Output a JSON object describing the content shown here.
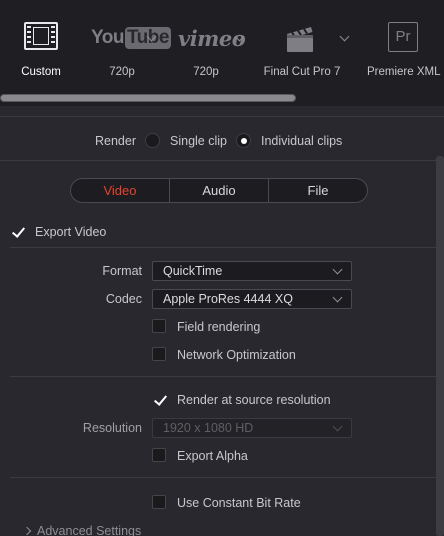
{
  "presets": [
    {
      "id": "custom",
      "label": "Custom",
      "icon": "film-icon",
      "active": true
    },
    {
      "id": "youtube",
      "label": "720p",
      "logo_you": "You",
      "logo_tube": "Tube"
    },
    {
      "id": "vimeo",
      "label": "720p",
      "logo": "vimeo"
    },
    {
      "id": "fcp7",
      "label": "Final Cut Pro 7",
      "icon": "clapperboard-icon"
    },
    {
      "id": "premiere",
      "label": "Premiere XML",
      "logo": "Pr"
    }
  ],
  "render": {
    "label": "Render",
    "options": [
      "Single clip",
      "Individual clips"
    ],
    "selected": "Individual clips"
  },
  "tabs": {
    "items": [
      "Video",
      "Audio",
      "File"
    ],
    "active": "Video",
    "active_color": "#e8432e"
  },
  "video": {
    "export_video": {
      "label": "Export Video",
      "checked": true
    },
    "format": {
      "label": "Format",
      "value": "QuickTime"
    },
    "codec": {
      "label": "Codec",
      "value": "Apple ProRes 4444 XQ"
    },
    "field_rendering": {
      "label": "Field rendering",
      "checked": false
    },
    "network_optimization": {
      "label": "Network Optimization",
      "checked": false
    },
    "render_at_source": {
      "label": "Render at source resolution",
      "checked": true
    },
    "resolution": {
      "label": "Resolution",
      "value": "1920 x 1080 HD",
      "disabled": true
    },
    "export_alpha": {
      "label": "Export Alpha",
      "checked": false
    },
    "constant_bit_rate": {
      "label": "Use Constant Bit Rate",
      "checked": false
    },
    "advanced": {
      "label": "Advanced Settings"
    }
  }
}
